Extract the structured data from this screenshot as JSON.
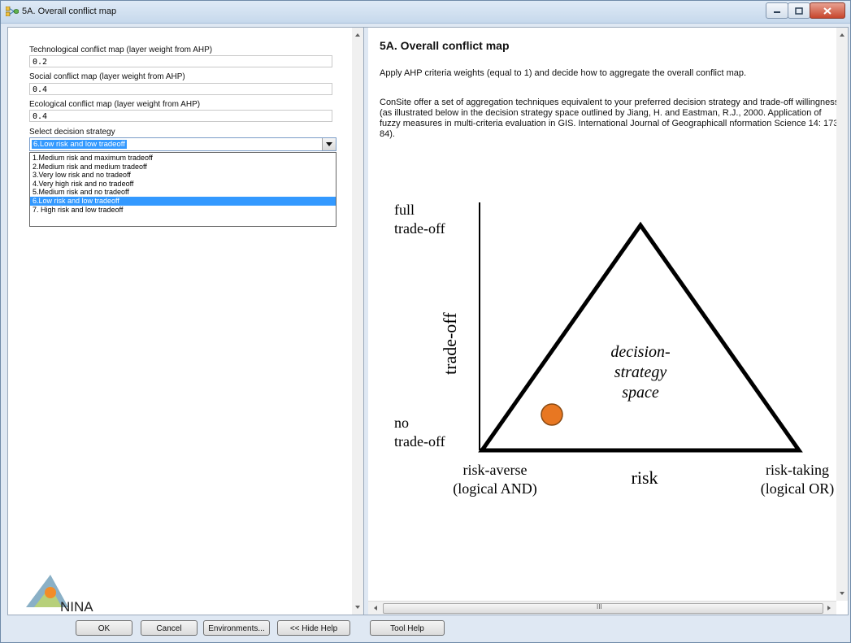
{
  "window": {
    "title": "5A. Overall conflict map"
  },
  "form": {
    "fields": [
      {
        "label": "Technological conflict map (layer weight  from AHP)",
        "value": "0.2"
      },
      {
        "label": "Social conflict map (layer weight from AHP)",
        "value": "0.4"
      },
      {
        "label": "Ecological conflict map (layer weight  from AHP)",
        "value": "0.4"
      }
    ],
    "strategy_label": "Select decision strategy",
    "strategy_selected": "6.Low risk and low tradeoff",
    "strategy_options": [
      "1.Medium risk and maximum tradeoff",
      "2.Medium risk and medium tradeoff",
      "3.Very low risk and no tradeoff",
      "4.Very high risk and no tradeoff",
      "5.Medium risk and no tradeoff",
      "6.Low risk and low tradeoff",
      "7. High risk and low tradeoff"
    ],
    "logo_text": "NINA"
  },
  "help": {
    "title": "5A. Overall conflict map",
    "paragraph1": "Apply AHP criteria weights (equal to 1) and decide how to aggregate the overall conflict map.",
    "paragraph2": "ConSite offer a set of aggregation techniques equivalent to your preferred decision strategy and trade-off willingness (as illustrated below in the decision strategy space outlined by Jiang, H. and Eastman, R.J., 2000. Application of fuzzy measures in multi-criteria evaluation in GIS. International Journal of Geographicall nformation Science 14: 173-84).",
    "diagram": {
      "full_line1": "full",
      "full_line2": "trade-off",
      "axis_y": "trade-off",
      "no_line1": "no",
      "no_line2": "trade-off",
      "center_line1": "decision-",
      "center_line2": "strategy",
      "center_line3": "space",
      "risk": "risk",
      "averse_line1": "risk-averse",
      "averse_line2": "(logical AND)",
      "taking_line1": "risk-taking",
      "taking_line2": "(logical OR)",
      "marker_color": "#e87722"
    },
    "scroll_glyph": "III"
  },
  "buttons": {
    "ok": "OK",
    "cancel": "Cancel",
    "environments": "Environments...",
    "hide_help": "<< Hide Help",
    "tool_help": "Tool Help"
  }
}
